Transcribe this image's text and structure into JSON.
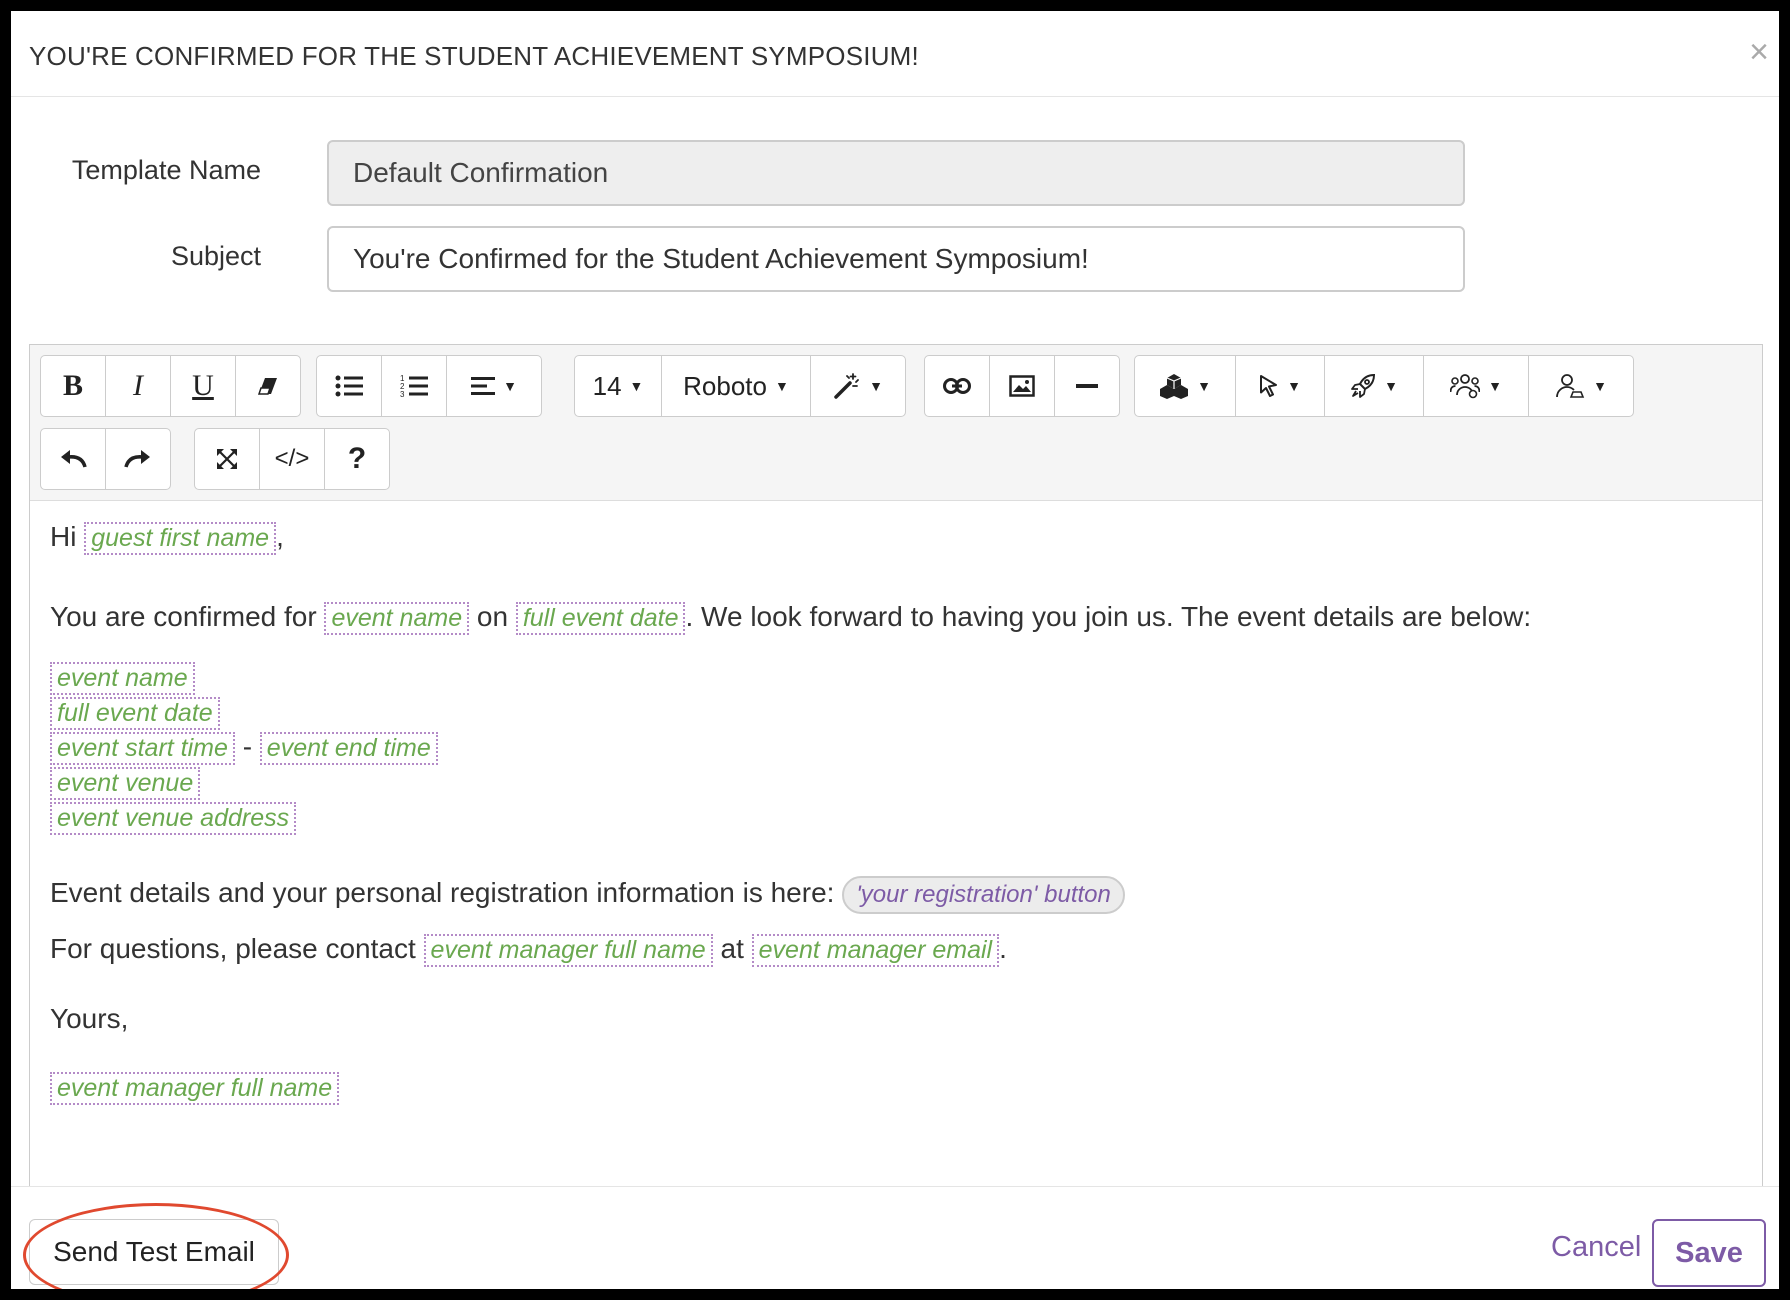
{
  "modal": {
    "title": "YOU'RE CONFIRMED FOR THE STUDENT ACHIEVEMENT SYMPOSIUM!",
    "close_label": "×"
  },
  "form": {
    "template_name_label": "Template Name",
    "template_name_value": "Default Confirmation",
    "subject_label": "Subject",
    "subject_value": "You're Confirmed for the Student Achievement Symposium!"
  },
  "toolbar": {
    "bold": "B",
    "italic": "I",
    "underline": "U",
    "font_size": "14",
    "font_family": "Roboto",
    "help": "?",
    "code": "</>",
    "icons": [
      "bold-icon",
      "italic-icon",
      "underline-icon",
      "eraser-icon",
      "unordered-list-icon",
      "ordered-list-icon",
      "align-icon",
      "magic-wand-icon",
      "link-icon",
      "image-icon",
      "horizontal-rule-icon",
      "blocks-icon",
      "cursor-icon",
      "rocket-icon",
      "users-icon",
      "user-icon",
      "undo-icon",
      "redo-icon",
      "fullscreen-icon",
      "code-view-icon",
      "help-icon"
    ]
  },
  "content": {
    "hi": "Hi",
    "comma": ",",
    "guest_first_name": "guest first name",
    "confirmed_prefix": "You are confirmed for",
    "event_name": "event name",
    "on": "on",
    "full_event_date": "full event date",
    "confirmed_suffix": ". We look forward to having you join us. The event details are below:",
    "event_start_time": "event start time",
    "dash": "-",
    "event_end_time": "event end time",
    "event_venue": "event venue",
    "event_venue_address": "event venue address",
    "details_text": "Event details and your personal registration information is here:",
    "registration_button": "'your registration' button",
    "questions_prefix": "For questions, please contact",
    "event_manager_full_name": "event manager full name",
    "at": "at",
    "event_manager_email": "event manager email",
    "period": ".",
    "yours": "Yours,"
  },
  "footer": {
    "send_test_label": "Send Test Email",
    "cancel_label": "Cancel",
    "save_label": "Save"
  },
  "colors": {
    "accent": "#7d5ba6",
    "merge_field_text": "#6aa84f",
    "annotation_ring": "#e0492f"
  }
}
